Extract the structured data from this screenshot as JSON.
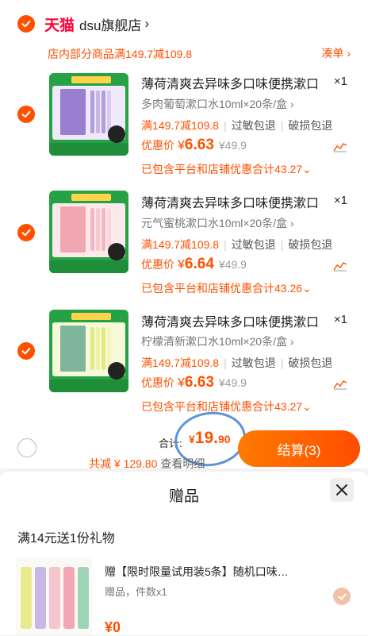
{
  "store": {
    "platform": "天猫",
    "name": "dsu旗舰店",
    "arrow": "›",
    "promo": "店内部分商品满149.7减109.8",
    "collect": "凑单 ›"
  },
  "items": [
    {
      "title": "薄荷清爽去异味多口味便携漱口",
      "qty": "×1",
      "variant": "多肉葡萄漱口水10ml×20条/盒 ›",
      "tag1": "满149.7减109.8",
      "tag2": "过敏包退",
      "tag3": "破损包退",
      "price_label": "优惠价",
      "currency": "¥",
      "price": "6.63",
      "original": "¥49.9",
      "discount": "已包含平台和店铺优惠合计43.27⌄",
      "theme": "#c9b7e8"
    },
    {
      "title": "薄荷清爽去异味多口味便携漱口",
      "qty": "×1",
      "variant": "元气蜜桃漱口水10ml×20条/盒 ›",
      "tag1": "满149.7减109.8",
      "tag2": "过敏包退",
      "tag3": "破损包退",
      "price_label": "优惠价",
      "currency": "¥",
      "price": "6.64",
      "original": "¥49.9",
      "discount": "已包含平台和店铺优惠合计43.26⌄",
      "theme": "#f5c6cc"
    },
    {
      "title": "薄荷清爽去异味多口味便携漱口",
      "qty": "×1",
      "variant": "柠檬清新漱口水10ml×20条/盒 ›",
      "tag1": "满149.7减109.8",
      "tag2": "过敏包退",
      "tag3": "破损包退",
      "price_label": "优惠价",
      "currency": "¥",
      "price": "6.63",
      "original": "¥49.9",
      "discount": "已包含平台和店铺优惠合计43.27⌄",
      "theme": "#e8ef9a"
    }
  ],
  "footer": {
    "total_label": "合计:",
    "currency": "¥",
    "total_int": "19.",
    "total_dec": "90",
    "savings": "共减 ¥ 129.80",
    "details": "查看明细",
    "checkout": "结算(3)"
  },
  "sheet": {
    "title": "赠品",
    "heading": "满14元送1份礼物",
    "gift_name": "赠【限时限量试用装5条】随机口味…",
    "gift_desc": "赠品，件数x1",
    "gift_price": "¥0"
  },
  "colors": {
    "accent": "#ff5000",
    "tmall": "#ff0036",
    "annotation_circle": "#5a94d8"
  }
}
